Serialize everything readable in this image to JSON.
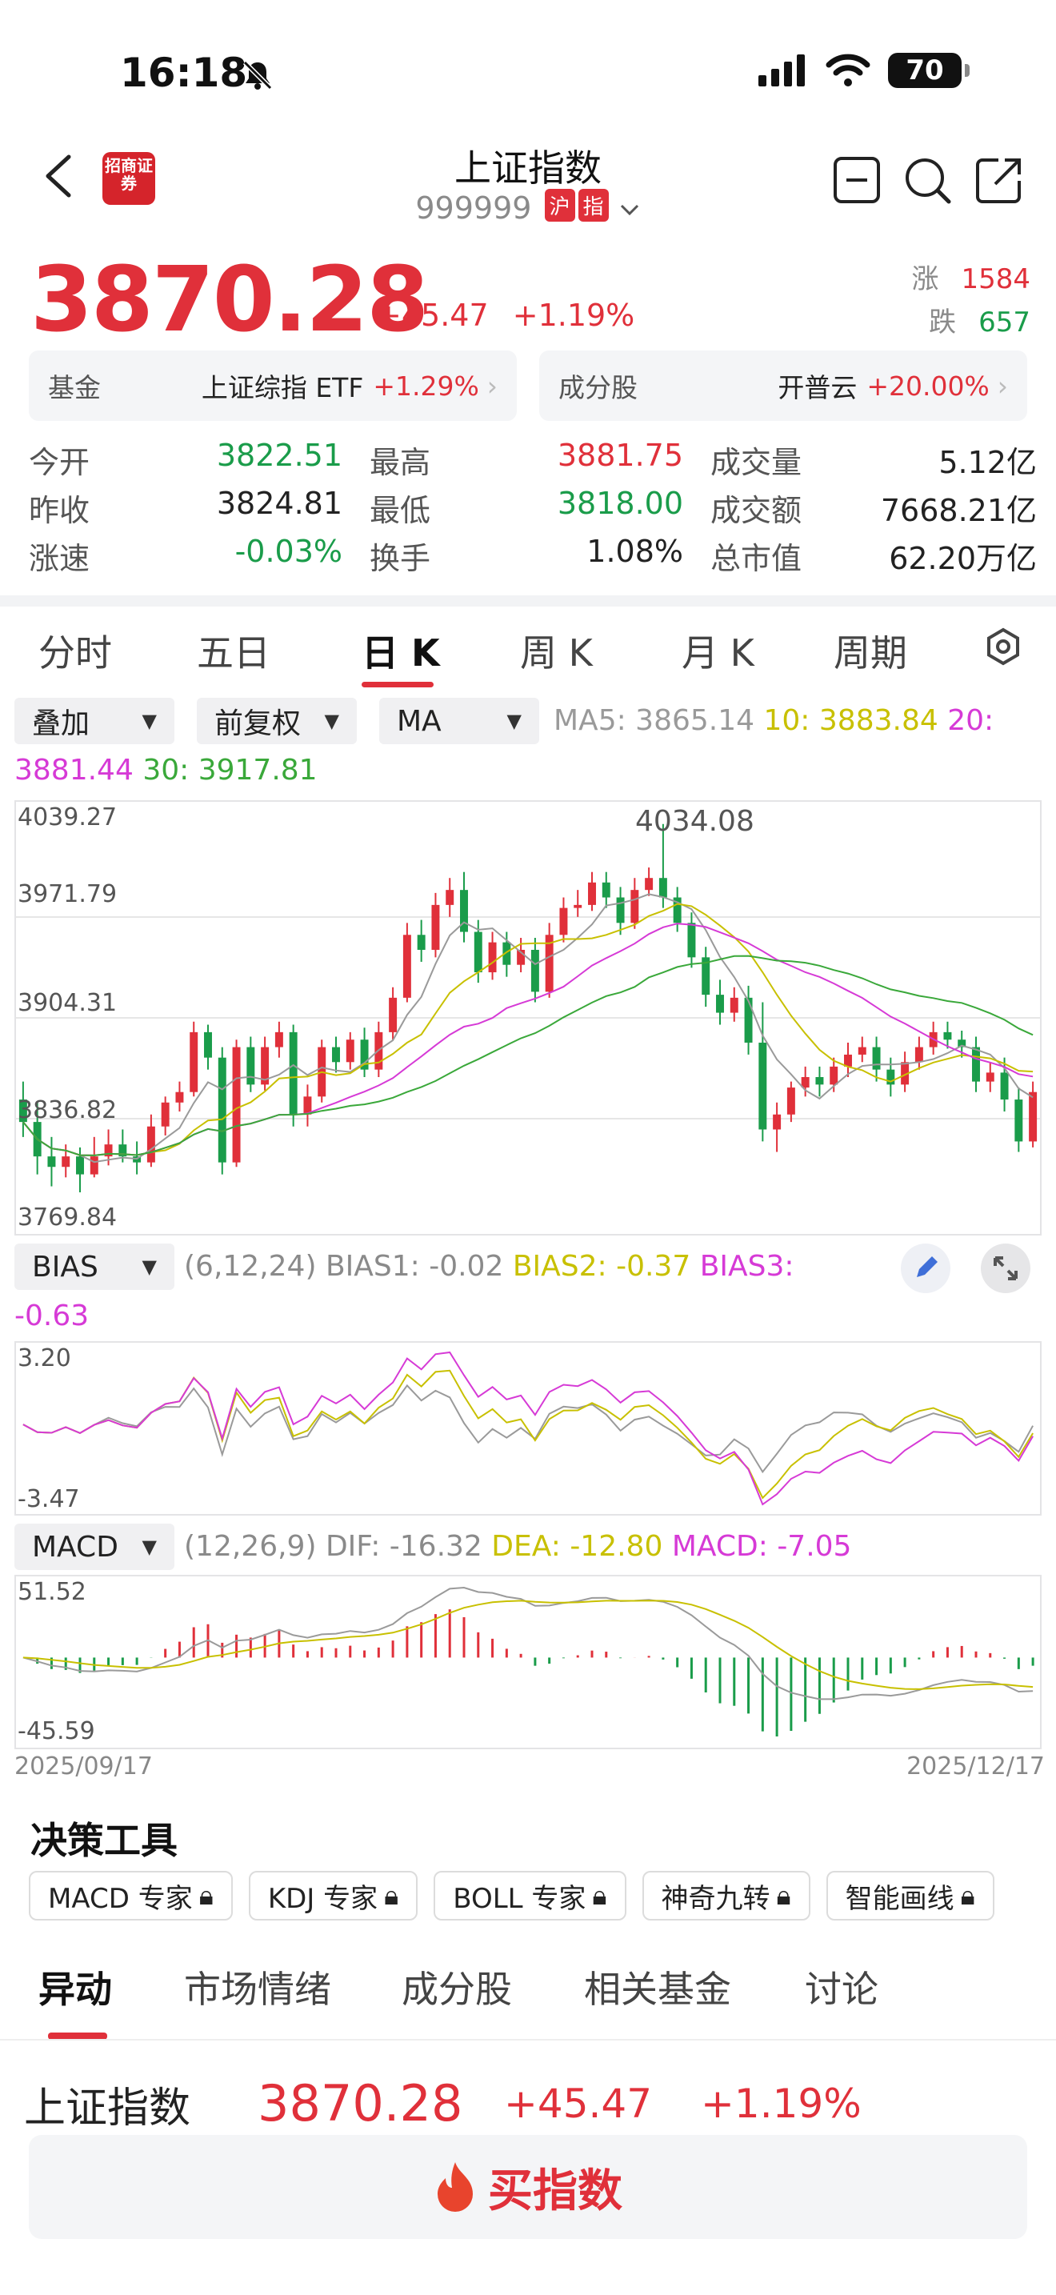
{
  "status": {
    "time": "16:18",
    "battery": "70"
  },
  "header": {
    "logo_text": "招商证券",
    "title": "上证指数",
    "code": "999999",
    "tag_market": "沪",
    "tag_type": "指"
  },
  "quote": {
    "price": "3870.28",
    "change": "+45.47",
    "change_pct": "+1.19%",
    "up_label": "涨",
    "up_count": "1584",
    "down_label": "跌",
    "down_count": "657"
  },
  "cards": {
    "fund": {
      "label": "基金",
      "name": "上证综指 ETF",
      "pct": "+1.29%"
    },
    "component": {
      "label": "成分股",
      "name": "开普云",
      "pct": "+20.00%"
    }
  },
  "stats": [
    [
      {
        "k": "今开",
        "v": "3822.51",
        "c": "green"
      },
      {
        "k": "最高",
        "v": "3881.75",
        "c": "red"
      },
      {
        "k": "成交量",
        "v": "5.12亿",
        "c": ""
      }
    ],
    [
      {
        "k": "昨收",
        "v": "3824.81",
        "c": ""
      },
      {
        "k": "最低",
        "v": "3818.00",
        "c": "green"
      },
      {
        "k": "成交额",
        "v": "7668.21亿",
        "c": ""
      }
    ],
    [
      {
        "k": "涨速",
        "v": "-0.03%",
        "c": "green"
      },
      {
        "k": "换手",
        "v": "1.08%",
        "c": ""
      },
      {
        "k": "总市值",
        "v": "62.20万亿",
        "c": ""
      }
    ]
  ],
  "period_tabs": [
    "分时",
    "五日",
    "日 K",
    "周 K",
    "月 K",
    "周期"
  ],
  "selectors": {
    "overlay": "叠加",
    "adjust": "前复权",
    "ma": "MA"
  },
  "ma_legend": {
    "ma5": "MA5: 3865.14",
    "ma10": "10: 3883.84",
    "ma20": "20:",
    "ma20_val": "3881.44",
    "ma30": "30: 3917.81"
  },
  "colors": {
    "red": "#e0303a",
    "green": "#1a9c4a",
    "ma5": "#9a9a9a",
    "ma10": "#c8c000",
    "ma20": "#d63ad6",
    "ma30": "#3aa83a"
  },
  "kline_axis": {
    "top": "4039.27",
    "mid1": "3971.79",
    "mid2": "3904.31",
    "mid3": "3836.82",
    "bottom": "3769.84",
    "max_label": "4034.08"
  },
  "bias": {
    "selector": "BIAS",
    "params": "(6,12,24)",
    "b1": "BIAS1: -0.02",
    "b2": "BIAS2: -0.37",
    "b3": "BIAS3:",
    "b3_val": "-0.63",
    "axis_top": "3.20",
    "axis_bottom": "-3.47"
  },
  "macd": {
    "selector": "MACD",
    "params": "(12,26,9)",
    "dif": "DIF: -16.32",
    "dea": "DEA: -12.80",
    "macd": "MACD: -7.05",
    "axis_top": "51.52",
    "axis_bottom": "-45.59"
  },
  "dates": {
    "start": "2025/09/17",
    "end": "2025/12/17"
  },
  "tools": {
    "title": "决策工具",
    "items": [
      "MACD 专家",
      "KDJ 专家",
      "BOLL 专家",
      "神奇九转",
      "智能画线"
    ]
  },
  "bottom_tabs": [
    "异动",
    "市场情绪",
    "成分股",
    "相关基金",
    "讨论"
  ],
  "ticker": {
    "name": "上证指数",
    "price": "3870.28",
    "change": "+45.47",
    "pct": "+1.19%"
  },
  "buy_button": "买指数",
  "chart_data": {
    "type": "candlestick",
    "title": "",
    "ylim": [
      3769.84,
      4039.27
    ],
    "x_range": [
      "2025/09/17",
      "2025/12/17"
    ],
    "candles": [
      [
        3850,
        3835,
        3862,
        3825
      ],
      [
        3835,
        3812,
        3848,
        3800
      ],
      [
        3812,
        3805,
        3825,
        3792
      ],
      [
        3805,
        3812,
        3820,
        3798
      ],
      [
        3812,
        3800,
        3818,
        3788
      ],
      [
        3800,
        3812,
        3825,
        3798
      ],
      [
        3812,
        3820,
        3830,
        3806
      ],
      [
        3820,
        3812,
        3830,
        3808
      ],
      [
        3812,
        3808,
        3822,
        3800
      ],
      [
        3808,
        3832,
        3840,
        3805
      ],
      [
        3832,
        3848,
        3852,
        3826
      ],
      [
        3848,
        3855,
        3862,
        3842
      ],
      [
        3855,
        3895,
        3902,
        3852
      ],
      [
        3895,
        3878,
        3900,
        3870
      ],
      [
        3878,
        3808,
        3885,
        3800
      ],
      [
        3808,
        3885,
        3890,
        3805
      ],
      [
        3885,
        3860,
        3892,
        3855
      ],
      [
        3860,
        3885,
        3892,
        3856
      ],
      [
        3885,
        3895,
        3902,
        3878
      ],
      [
        3895,
        3840,
        3900,
        3832
      ],
      [
        3840,
        3852,
        3860,
        3832
      ],
      [
        3852,
        3885,
        3890,
        3848
      ],
      [
        3885,
        3875,
        3892,
        3868
      ],
      [
        3875,
        3890,
        3895,
        3870
      ],
      [
        3890,
        3870,
        3898,
        3865
      ],
      [
        3870,
        3895,
        3902,
        3865
      ],
      [
        3895,
        3918,
        3925,
        3890
      ],
      [
        3918,
        3960,
        3968,
        3915
      ],
      [
        3960,
        3950,
        3970,
        3942
      ],
      [
        3950,
        3980,
        3988,
        3945
      ],
      [
        3980,
        3990,
        3998,
        3972
      ],
      [
        3990,
        3962,
        4002,
        3955
      ],
      [
        3962,
        3935,
        3970,
        3928
      ],
      [
        3935,
        3955,
        3962,
        3930
      ],
      [
        3955,
        3940,
        3962,
        3932
      ],
      [
        3940,
        3950,
        3958,
        3935
      ],
      [
        3950,
        3922,
        3958,
        3915
      ],
      [
        3922,
        3960,
        3968,
        3918
      ],
      [
        3960,
        3978,
        3985,
        3955
      ],
      [
        3978,
        3980,
        3990,
        3972
      ],
      [
        3980,
        3995,
        4002,
        3976
      ],
      [
        3995,
        3985,
        4002,
        3978
      ],
      [
        3985,
        3968,
        3992,
        3960
      ],
      [
        3968,
        3990,
        3998,
        3964
      ],
      [
        3990,
        3998,
        4005,
        3986
      ],
      [
        3998,
        3985,
        4034.08,
        3978
      ],
      [
        3985,
        3968,
        3992,
        3962
      ],
      [
        3968,
        3945,
        3975,
        3938
      ],
      [
        3945,
        3920,
        3952,
        3912
      ],
      [
        3920,
        3908,
        3930,
        3900
      ],
      [
        3908,
        3918,
        3925,
        3902
      ],
      [
        3918,
        3888,
        3926,
        3880
      ],
      [
        3888,
        3830,
        3915,
        3822
      ],
      [
        3830,
        3840,
        3848,
        3815
      ],
      [
        3840,
        3858,
        3862,
        3835
      ],
      [
        3858,
        3865,
        3872,
        3852
      ],
      [
        3865,
        3860,
        3872,
        3852
      ],
      [
        3860,
        3872,
        3878,
        3855
      ],
      [
        3872,
        3880,
        3888,
        3865
      ],
      [
        3880,
        3885,
        3892,
        3875
      ],
      [
        3885,
        3870,
        3892,
        3862
      ],
      [
        3870,
        3860,
        3878,
        3852
      ],
      [
        3860,
        3875,
        3882,
        3855
      ],
      [
        3875,
        3885,
        3892,
        3870
      ],
      [
        3885,
        3895,
        3902,
        3880
      ],
      [
        3895,
        3890,
        3902,
        3884
      ],
      [
        3890,
        3885,
        3896,
        3878
      ],
      [
        3885,
        3862,
        3892,
        3855
      ],
      [
        3862,
        3868,
        3875,
        3855
      ],
      [
        3868,
        3850,
        3878,
        3842
      ],
      [
        3850,
        3822,
        3858,
        3815
      ],
      [
        3822,
        3855,
        3862,
        3818
      ]
    ]
  }
}
